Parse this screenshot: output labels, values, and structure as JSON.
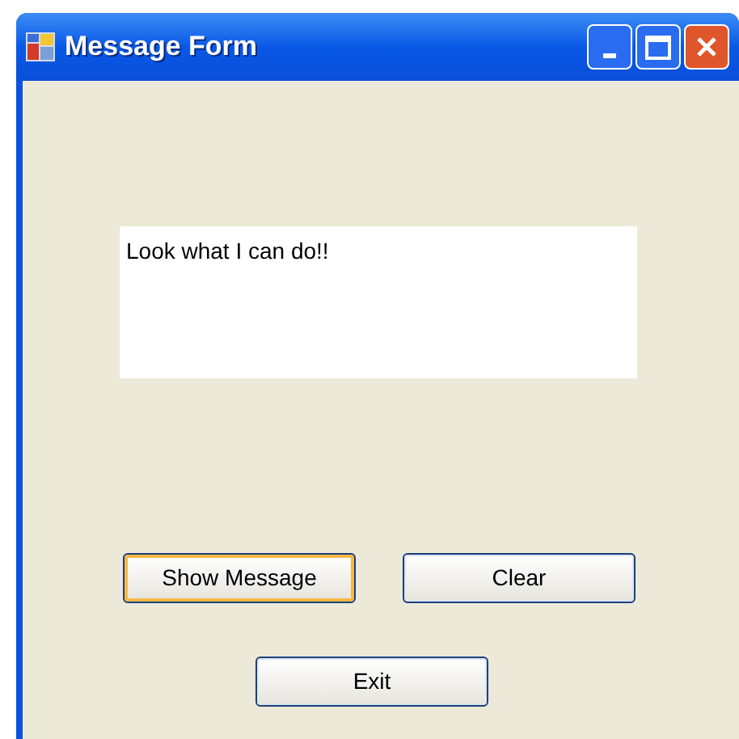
{
  "window": {
    "title": "Message Form"
  },
  "message_box": {
    "value": "Look what I can do!!"
  },
  "buttons": [
    {
      "label": "Show Message",
      "focused": true
    },
    {
      "label": "Clear",
      "focused": false
    },
    {
      "label": "Exit",
      "focused": false
    }
  ]
}
